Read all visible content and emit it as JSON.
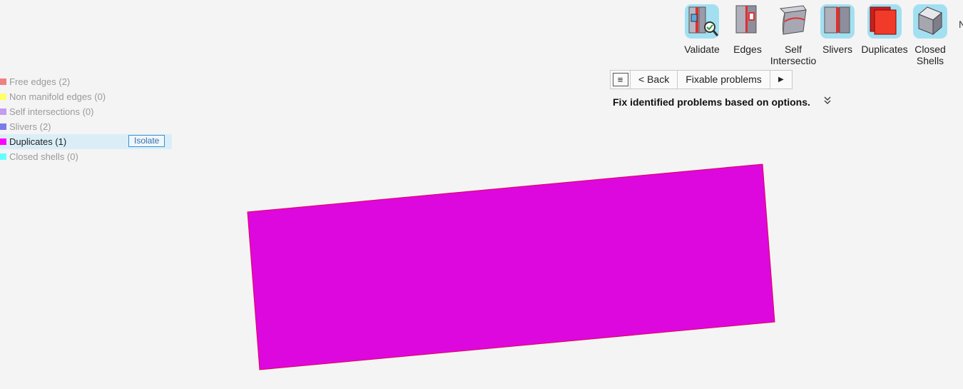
{
  "ribbon": {
    "tools": [
      {
        "id": "validate",
        "label": "Validate",
        "label2": "",
        "icon": "validate-icon"
      },
      {
        "id": "edges",
        "label": "Edges",
        "label2": "",
        "icon": "edges-icon"
      },
      {
        "id": "self-intersection",
        "label": "Self",
        "label2": "Intersectio",
        "icon": "self-intersection-icon"
      },
      {
        "id": "slivers",
        "label": "Slivers",
        "label2": "",
        "icon": "slivers-icon"
      },
      {
        "id": "duplicates",
        "label": "Duplicates",
        "label2": "",
        "icon": "duplicates-icon"
      },
      {
        "id": "closed-shells",
        "label": "Closed",
        "label2": "Shells",
        "icon": "closed-shells-icon"
      }
    ],
    "overflow_glyph": "N"
  },
  "legend": {
    "items": [
      {
        "label": "Free edges (2)",
        "color": "#f08080"
      },
      {
        "label": "Non manifold edges (0)",
        "color": "#ffff66"
      },
      {
        "label": "Self intersections (0)",
        "color": "#c39bf0"
      },
      {
        "label": "Slivers (2)",
        "color": "#7b7bea"
      },
      {
        "label": "Duplicates (1)",
        "color": "#ff00ff"
      },
      {
        "label": "Closed shells (0)",
        "color": "#66ffff"
      }
    ],
    "isolate_label": "Isolate"
  },
  "nav": {
    "menu_glyph": "≡",
    "back_label": "< Back",
    "current_label": "Fixable problems",
    "next_glyph": "▶"
  },
  "instruction": "Fix identified problems based on options.",
  "expand_glyph": "⌄⌄",
  "colors": {
    "duplicate_fill": "#dd08dd",
    "duplicate_edge": "#e0005a",
    "highlight": "#dbeef8",
    "accent": "#3a8fd0"
  }
}
